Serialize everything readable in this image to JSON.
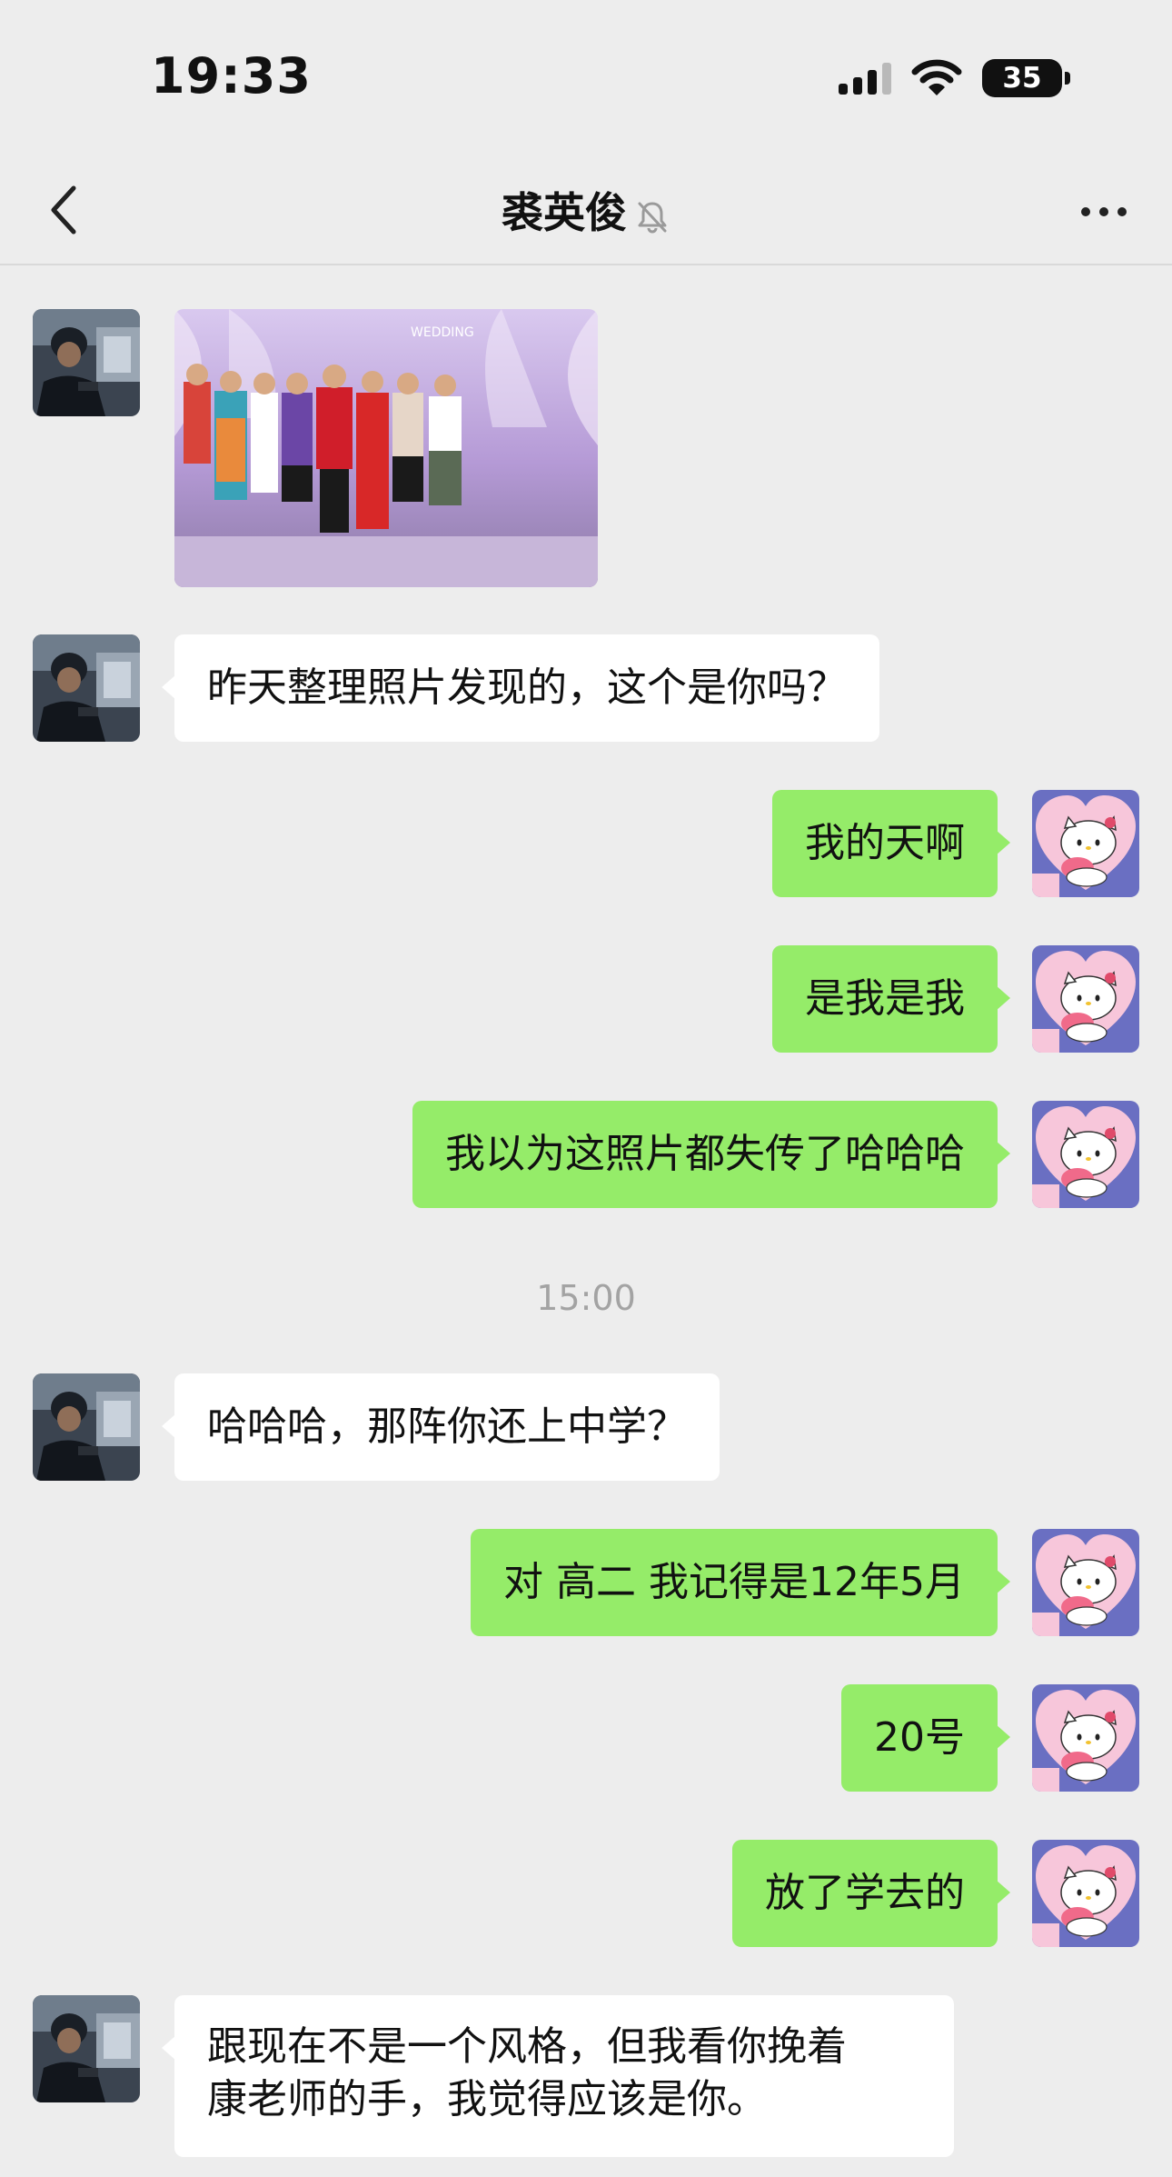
{
  "status_bar": {
    "time": "19:33",
    "battery": "35",
    "icons": [
      "cellular-signal-icon",
      "wifi-icon",
      "battery-icon"
    ]
  },
  "nav": {
    "title": "裘英俊",
    "icons": [
      "back-chevron-icon",
      "muted-bell-icon",
      "more-dots-icon"
    ]
  },
  "messages": [
    {
      "side": "in",
      "type": "image",
      "icon": "photo-thumbnail"
    },
    {
      "side": "in",
      "type": "text",
      "text": "昨天整理照片发现的，这个是你吗？"
    },
    {
      "side": "out",
      "type": "text",
      "text": "我的天啊"
    },
    {
      "side": "out",
      "type": "text",
      "text": "是我是我"
    },
    {
      "side": "out",
      "type": "text",
      "text": "我以为这照片都失传了哈哈哈"
    },
    {
      "side": "center",
      "type": "timestamp",
      "text": "15:00"
    },
    {
      "side": "in",
      "type": "text",
      "text": "哈哈哈，那阵你还上中学？"
    },
    {
      "side": "out",
      "type": "text",
      "text": "对 高二 我记得是12年5月"
    },
    {
      "side": "out",
      "type": "text",
      "text": "20号"
    },
    {
      "side": "out",
      "type": "text",
      "text": "放了学去的"
    },
    {
      "side": "in",
      "type": "text",
      "lines": [
        "跟现在不是一个风格，但我看你挽着",
        "康老师的手，我觉得应该是你。"
      ]
    }
  ],
  "colors": {
    "background": "#ededed",
    "incoming_bubble": "#ffffff",
    "outgoing_bubble": "#95ec69",
    "timestamp_text": "#a3a3a3"
  }
}
